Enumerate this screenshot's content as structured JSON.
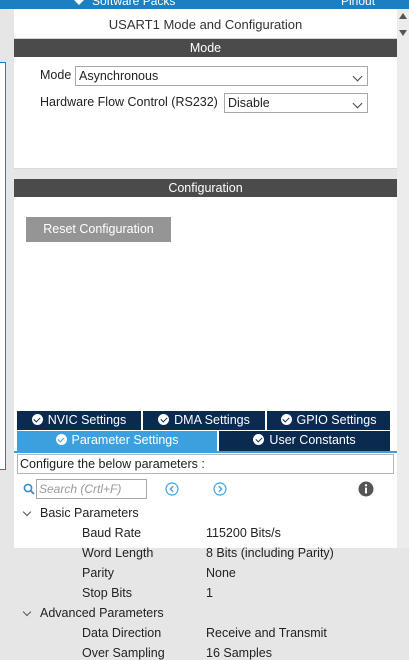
{
  "topbar": {
    "left_text": "Software Packs",
    "right_text": "Pinout"
  },
  "panel": {
    "title": "USART1 Mode and Configuration"
  },
  "mode": {
    "header": "Mode",
    "mode_label": "Mode",
    "mode_value": "Asynchronous",
    "flow_label": "Hardware Flow Control (RS232)",
    "flow_value": "Disable"
  },
  "config": {
    "header": "Configuration",
    "reset_label": "Reset Configuration",
    "tabs": [
      {
        "label": "NVIC Settings",
        "active": false
      },
      {
        "label": "DMA Settings",
        "active": false
      },
      {
        "label": "GPIO Settings",
        "active": false
      },
      {
        "label": "Parameter Settings",
        "active": true
      },
      {
        "label": "User Constants",
        "active": false
      }
    ],
    "configure_text": "Configure the below parameters :",
    "search_placeholder": "Search (Crtl+F)",
    "groups": [
      {
        "name": "Basic Parameters",
        "params": [
          {
            "name": "Baud Rate",
            "value": "115200 Bits/s"
          },
          {
            "name": "Word Length",
            "value": "8 Bits (including Parity)"
          },
          {
            "name": "Parity",
            "value": "None"
          },
          {
            "name": "Stop Bits",
            "value": "1"
          }
        ]
      },
      {
        "name": "Advanced Parameters",
        "params": [
          {
            "name": "Data Direction",
            "value": "Receive and Transmit"
          },
          {
            "name": "Over Sampling",
            "value": "16 Samples"
          }
        ]
      }
    ]
  },
  "colors": {
    "accent": "#3ba0dd",
    "tab_dark": "#0a2a4f",
    "header_dark": "#4b4b4b",
    "topbar": "#1b7fc1"
  },
  "icons": [
    "search-icon",
    "prev-icon",
    "next-icon",
    "info-icon",
    "check-icon",
    "chevron-down-icon"
  ]
}
